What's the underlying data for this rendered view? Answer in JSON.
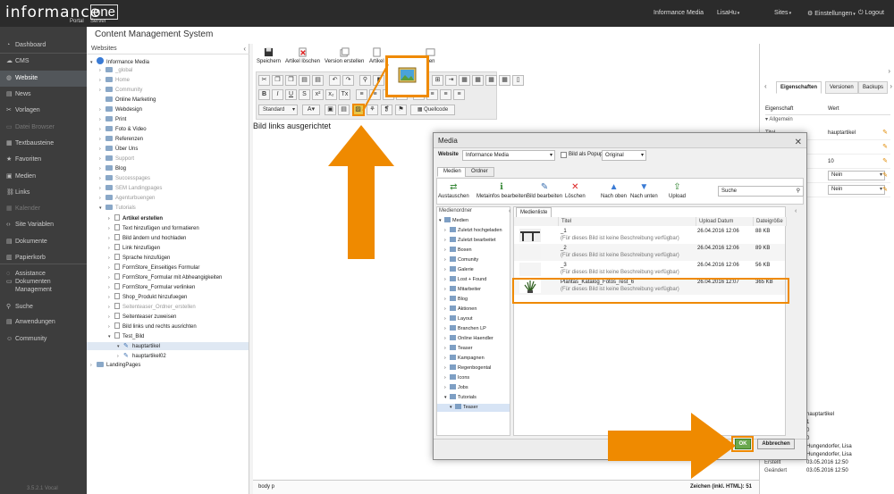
{
  "topbar": {
    "logo_main": "informance",
    "logo_one": "one",
    "logo_sub1": "Portal",
    "logo_sub2": "Server",
    "org": "Informance Media",
    "user": "LisaHu",
    "sites": "Sites",
    "settings": "Einstellungen",
    "logout": "Logout"
  },
  "sidebar": {
    "items": [
      {
        "label": "Dashboard",
        "icon": "gauge-icon"
      },
      {
        "label": "CMS",
        "icon": "cms-icon"
      },
      {
        "label": "Website",
        "icon": "globe-icon"
      },
      {
        "label": "News",
        "icon": "news-icon"
      },
      {
        "label": "Vorlagen",
        "icon": "template-icon"
      },
      {
        "label": "Datei Browser",
        "icon": "file-icon"
      },
      {
        "label": "Textbausteine",
        "icon": "textblock-icon"
      },
      {
        "label": "Favoriten",
        "icon": "star-icon"
      },
      {
        "label": "Medien",
        "icon": "media-icon"
      },
      {
        "label": "Links",
        "icon": "link-icon"
      },
      {
        "label": "Kalender",
        "icon": "calendar-icon"
      },
      {
        "label": "Site Variablen",
        "icon": "code-icon"
      },
      {
        "label": "Dokumente",
        "icon": "document-icon"
      },
      {
        "label": "Papierkorb",
        "icon": "trash-icon"
      },
      {
        "label": "Assistance",
        "icon": "assistance-icon"
      },
      {
        "label": "Dokumenten",
        "icon": "docs-icon"
      },
      {
        "label": "Management",
        "icon": ""
      },
      {
        "label": "Suche",
        "icon": "search-icon"
      },
      {
        "label": "Anwendungen",
        "icon": "apps-icon"
      },
      {
        "label": "Community",
        "icon": "community-icon"
      }
    ],
    "version": "3.5.2.1 Vocal"
  },
  "page": {
    "title": "Content Management System"
  },
  "tree": {
    "header": "Websites",
    "rows": [
      {
        "label": "Informance Media"
      },
      {
        "label": "_global"
      },
      {
        "label": "Home"
      },
      {
        "label": "Community"
      },
      {
        "label": "Online Marketing"
      },
      {
        "label": "Webdesign"
      },
      {
        "label": "Print"
      },
      {
        "label": "Foto & Video"
      },
      {
        "label": "Referenzen"
      },
      {
        "label": "Über Uns"
      },
      {
        "label": "Support"
      },
      {
        "label": "Blog"
      },
      {
        "label": "Successpages"
      },
      {
        "label": "SEM Landingpages"
      },
      {
        "label": "Agenturbuengen"
      },
      {
        "label": "Tutorials"
      },
      {
        "label": "Artikel erstellen"
      },
      {
        "label": "Text hinzufügen und formatieren"
      },
      {
        "label": "Bild ändern und hochladen"
      },
      {
        "label": "Link hinzufügen"
      },
      {
        "label": "Sprache hinzufügen"
      },
      {
        "label": "FormStore_Einseitiges Formular"
      },
      {
        "label": "FormStore_Formular mit Abheangigkeiten"
      },
      {
        "label": "FormStore_Formular verlinken"
      },
      {
        "label": "Shop_Produkt hinzufuegen"
      },
      {
        "label": "Seitenteaser_Ordner_erstellen"
      },
      {
        "label": "Seitenteaser zuweisen"
      },
      {
        "label": "Bild links und rechts ausrichten"
      },
      {
        "label": "Test_Bild"
      },
      {
        "label": "hauptartikel"
      },
      {
        "label": "hauptartikel02"
      },
      {
        "label": "LandingPages"
      }
    ]
  },
  "editor": {
    "toolbar": {
      "save": "Speichern",
      "delete": "Artikel löschen",
      "version": "Version erstellen",
      "article": "Artikel",
      "preview": "hen",
      "style_select": "Standard",
      "source": "Quellcode"
    },
    "content": "Bild links ausgerichtet",
    "status_path": "body  p",
    "char_count": "Zeichen (inkl. HTML): 51"
  },
  "right_panel": {
    "tabs": [
      "Eigenschaften",
      "Versionen",
      "Backups"
    ],
    "col_prop": "Eigenschaft",
    "col_value": "Wert",
    "section": "Allgemein",
    "rows": [
      {
        "label": "Titel",
        "value": "hauptartikel"
      },
      {
        "label": "",
        "value": ""
      },
      {
        "label": "",
        "value": "10"
      },
      {
        "label": "",
        "value": "Nein"
      },
      {
        "label": "",
        "value": "Nein"
      }
    ],
    "details": [
      {
        "label": "",
        "value": "hauptartikel"
      },
      {
        "label": "",
        "value": "1"
      },
      {
        "label": "",
        "value": "0"
      },
      {
        "label": "",
        "value": "0"
      },
      {
        "label": "",
        "value": "Hungendorfer, Lisa"
      },
      {
        "label": "Bearbeiter",
        "value": "Hungendorfer, Lisa"
      },
      {
        "label": "Erstellt",
        "value": "03.05.2016 12:50"
      },
      {
        "label": "Geändert",
        "value": "03.05.2016 12:50"
      }
    ]
  },
  "modal": {
    "title": "Media",
    "website_label": "Website",
    "website_value": "Informance Media",
    "popup_label": "Bild als Popup",
    "popup_value": "Original",
    "tabs": [
      "Medien",
      "Ordner"
    ],
    "toolbar": [
      {
        "label": "Austauschen"
      },
      {
        "label": "Metainfos bearbeiten"
      },
      {
        "label": "Bild bearbeiten"
      },
      {
        "label": "Löschen"
      },
      {
        "label": "Nach oben"
      },
      {
        "label": "Nach unten"
      },
      {
        "label": "Upload"
      }
    ],
    "search_placeholder": "Suche",
    "folder_header": "Medienordner",
    "folders": [
      {
        "label": "Medien"
      },
      {
        "label": "Zuletzt hochgeladen"
      },
      {
        "label": "Zuletzt bearbeitet"
      },
      {
        "label": "Boxen"
      },
      {
        "label": "Comunity"
      },
      {
        "label": "Galerie"
      },
      {
        "label": "Lost + Found"
      },
      {
        "label": "Mitarbeiter"
      },
      {
        "label": "Blog"
      },
      {
        "label": "Aktionen"
      },
      {
        "label": "Layout"
      },
      {
        "label": "Branchen LP"
      },
      {
        "label": "Online Haendler"
      },
      {
        "label": "Teaser"
      },
      {
        "label": "Kampagnen"
      },
      {
        "label": "Regenbogental"
      },
      {
        "label": "Icons"
      },
      {
        "label": "Jobs"
      },
      {
        "label": "Tutorials"
      },
      {
        "label": "Teaser"
      }
    ],
    "list_tab": "Medienliste",
    "columns": [
      "Titel",
      "Upload Datum",
      "Dateigröße"
    ],
    "items": [
      {
        "title": "_1",
        "desc": "(Für dieses Bild ist keine Beschreibung verfügbar)",
        "date": "26.04.2016 12:06",
        "size": "88 KB"
      },
      {
        "title": "_2",
        "desc": "(Für dieses Bild ist keine Beschreibung verfügbar)",
        "date": "26.04.2016 12:06",
        "size": "89 KB"
      },
      {
        "title": "_3",
        "desc": "(Für dieses Bild ist keine Beschreibung verfügbar)",
        "date": "26.04.2016 12:06",
        "size": "56 KB"
      },
      {
        "title": "Plantas_Katalog_Fotos_rest_6",
        "desc": "(Für dieses Bild ist keine Beschreibung verfügbar)",
        "date": "26.04.2016 12:07",
        "size": "365 KB"
      }
    ],
    "ok": "OK",
    "cancel": "Abbrechen"
  },
  "colors": {
    "highlight": "#ef8a00",
    "ok_button": "#6aa84f",
    "sidebar_bg": "#3d3d3d"
  }
}
